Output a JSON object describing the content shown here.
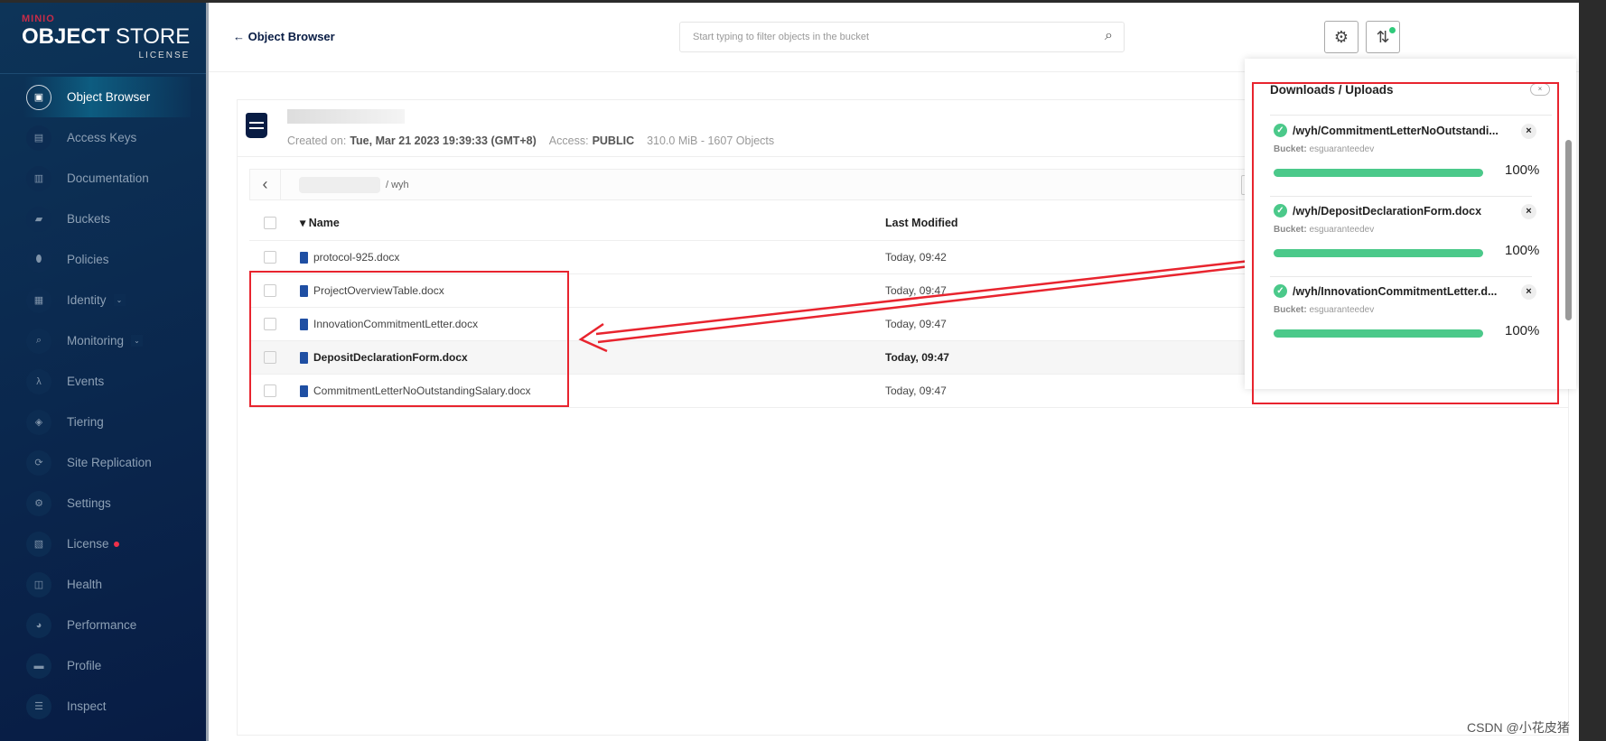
{
  "brand": {
    "minio": "MINIO",
    "object": "OBJECT",
    "store": " STORE",
    "license": "LICENSE"
  },
  "sidebar": {
    "items": [
      {
        "label": "Object Browser",
        "icon": "object-browser-icon",
        "glyph": "▣",
        "active": true
      },
      {
        "label": "Access Keys",
        "icon": "key-icon",
        "glyph": "▤"
      },
      {
        "label": "Documentation",
        "icon": "docs-icon",
        "glyph": "▥"
      },
      {
        "label": "Buckets",
        "icon": "bucket-icon",
        "glyph": "▰"
      },
      {
        "label": "Policies",
        "icon": "shield-icon",
        "glyph": "⬮"
      },
      {
        "label": "Identity",
        "icon": "identity-icon",
        "glyph": "▦",
        "chevron": true
      },
      {
        "label": "Monitoring",
        "icon": "monitoring-icon",
        "glyph": "⌕",
        "chevron": true
      },
      {
        "label": "Events",
        "icon": "lambda-icon",
        "glyph": "λ"
      },
      {
        "label": "Tiering",
        "icon": "tiering-icon",
        "glyph": "◈"
      },
      {
        "label": "Site Replication",
        "icon": "replication-icon",
        "glyph": "⟳"
      },
      {
        "label": "Settings",
        "icon": "settings-icon",
        "glyph": "⚙"
      },
      {
        "label": "License",
        "icon": "license-icon",
        "glyph": "▧",
        "dot": true
      },
      {
        "label": "Health",
        "icon": "health-icon",
        "glyph": "◫"
      },
      {
        "label": "Performance",
        "icon": "performance-icon",
        "glyph": "◕"
      },
      {
        "label": "Profile",
        "icon": "profile-icon",
        "glyph": "▬"
      },
      {
        "label": "Inspect",
        "icon": "inspect-icon",
        "glyph": "☰"
      }
    ]
  },
  "header": {
    "back_label": "Object Browser",
    "search_placeholder": "Start typing to filter objects in the bucket"
  },
  "bucket": {
    "created_label": "Created on:",
    "created": "Tue, Mar 21 2023 19:39:33 (GMT+8)",
    "access_label": "Access:",
    "access": "PUBLIC",
    "usage": "310.0 MiB - 1607 Objects",
    "path": "/ wyh"
  },
  "table": {
    "columns": [
      "Name",
      "Last Modified"
    ],
    "rows": [
      {
        "name": "protocol-925.docx",
        "modified": "Today, 09:42"
      },
      {
        "name": "ProjectOverviewTable.docx",
        "modified": "Today, 09:47"
      },
      {
        "name": "InnovationCommitmentLetter.docx",
        "modified": "Today, 09:47"
      },
      {
        "name": "DepositDeclarationForm.docx",
        "modified": "Today, 09:47",
        "highlight": true
      },
      {
        "name": "CommitmentLetterNoOutstandingSalary.docx",
        "modified": "Today, 09:47"
      }
    ]
  },
  "panel": {
    "title": "Downloads / Uploads",
    "bucket_label": "Bucket:",
    "items": [
      {
        "file": "/wyh/CommitmentLetterNoOutstandi...",
        "bucket": "esguaranteedev",
        "progress": 100,
        "pct": "100%"
      },
      {
        "file": "/wyh/DepositDeclarationForm.docx",
        "bucket": "esguaranteedev",
        "progress": 100,
        "pct": "100%"
      },
      {
        "file": "/wyh/InnovationCommitmentLetter.d...",
        "bucket": "esguaranteedev",
        "progress": 100,
        "pct": "100%"
      }
    ]
  },
  "colors": {
    "sidebar": "#0d3458",
    "accent": "#081c44",
    "progress": "#4bc98a",
    "annotation": "#e8242e"
  },
  "watermark": "CSDN @小花皮猪"
}
